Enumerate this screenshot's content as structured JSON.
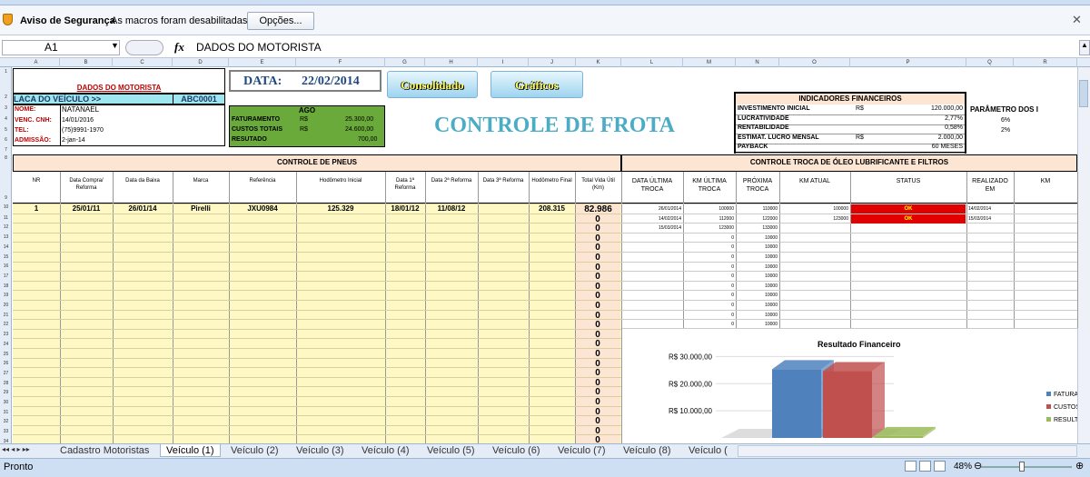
{
  "security_bar": {
    "title": "Aviso de Segurança",
    "message": "As macros foram desabilitadas.",
    "options_button": "Opções..."
  },
  "formula_bar": {
    "name_box": "A1",
    "fx": "fx",
    "value": "DADOS DO MOTORISTA"
  },
  "columns": [
    "A",
    "B",
    "C",
    "D",
    "E",
    "F",
    "G",
    "H",
    "I",
    "J",
    "K",
    "L",
    "M",
    "N",
    "O",
    "P",
    "Q",
    "R"
  ],
  "rows": [
    "1",
    "2",
    "3",
    "4",
    "5",
    "6",
    "7",
    "8",
    "9",
    "10",
    "11",
    "12",
    "13",
    "14",
    "15",
    "16",
    "17",
    "18",
    "19",
    "20",
    "21",
    "22",
    "23",
    "24",
    "25",
    "26",
    "27",
    "28",
    "29",
    "30",
    "31",
    "32",
    "33",
    "34"
  ],
  "motorista": {
    "title": "DADOS DO MOTORISTA",
    "placa_label": "LACA DO VEÍCULO >>",
    "placa_value": "ABC0001",
    "nome_label": "NOME:",
    "nome_value": "NATANAEL",
    "cnh_label": "VENC. CNH:",
    "cnh_value": "14/01/2016",
    "tel_label": "TEL:",
    "tel_value": "(75)9991-1970",
    "adm_label": "ADMISSÃO:",
    "adm_value": "2-jan-14"
  },
  "data_box": {
    "label": "DATA:",
    "value": "22/02/2014"
  },
  "buttons": {
    "consolidado": "Consolidado",
    "graficos": "Gráficos"
  },
  "mes": {
    "month": "AGO",
    "fat_label": "FATURAMENTO",
    "fat_cur": "R$",
    "fat_val": "25.300,00",
    "custo_label": "CUSTOS TOTAIS",
    "custo_cur": "R$",
    "custo_val": "24.600,00",
    "res_label": "RESUTADO",
    "res_val": "700,00"
  },
  "main_title": "CONTROLE DE FROTA",
  "indicadores": {
    "title": "INDICADORES FINANCEIROS",
    "rows": [
      {
        "label": "INVESTIMENTO INICIAL",
        "cur": "R$",
        "value": "120.000,00"
      },
      {
        "label": "LUCRATIVIDADE",
        "cur": "",
        "value": "2,77%"
      },
      {
        "label": "RENTABILIDADE",
        "cur": "",
        "value": "0,58%"
      },
      {
        "label": "ESTIMAT. LUCRO MENSAL",
        "cur": "R$",
        "value": "2.000,00"
      },
      {
        "label": "PAYBACK",
        "cur": "",
        "value": "60   MESES"
      }
    ],
    "param_title": "PARÂMETRO DOS I",
    "param_vals": [
      "6%",
      "2%"
    ]
  },
  "pneus": {
    "title": "CONTROLE DE PNEUS",
    "headers": [
      "NR",
      "Data Compra/ Reforma",
      "Data da Baixa",
      "Marca",
      "Referência",
      "Hodômetro Inicial",
      "Data 1ª Reforma",
      "Data 2ª Reforma",
      "Data 3ª Reforma",
      "Hodômetro Final",
      "Total Vida Útil (Km)"
    ],
    "row1": [
      "1",
      "25/01/11",
      "26/01/14",
      "Pirelli",
      "JXU0984",
      "125.329",
      "18/01/12",
      "11/08/12",
      "",
      "208.315",
      "82.986"
    ],
    "zero": "0"
  },
  "oleo": {
    "title": "CONTROLE TROCA DE ÓLEO LUBRIFICANTE E FILTROS",
    "headers": [
      "DATA ÚLTIMA TROCA",
      "KM ÚLTIMA TROCA",
      "PRÓXIMA TROCA",
      "KM ATUAL",
      "STATUS",
      "REALIZADO EM",
      "KM"
    ],
    "rows": [
      [
        "26/01/2014",
        "100000",
        "110000",
        "100000",
        "OK",
        "14/02/2014"
      ],
      [
        "14/02/2014",
        "112000",
        "122000",
        "123000",
        "OK",
        "15/03/2014"
      ],
      [
        "15/03/2014",
        "123000",
        "133000",
        "",
        "",
        ""
      ]
    ],
    "zero_km": "0",
    "next_default": "10000"
  },
  "chart_data": {
    "type": "bar",
    "title": "Resultado Financeiro",
    "categories": [
      "FATURAMENTO",
      "CUSTOS",
      "RESULTADO"
    ],
    "values": [
      25300,
      24600,
      700
    ],
    "ytick_labels": [
      "R$ 30.000,00",
      "R$ 20.000,00",
      "R$ 10.000,00"
    ],
    "legend": [
      "FATURAN",
      "CUSTOS",
      "RESULTAD"
    ],
    "colors": [
      "#4f81bd",
      "#c0504d",
      "#9bbb59"
    ],
    "ylim": [
      0,
      30000
    ]
  },
  "tabs": [
    "Cadastro Motoristas",
    "Veículo (1)",
    "Veículo (2)",
    "Veículo (3)",
    "Veículo (4)",
    "Veículo (5)",
    "Veículo (6)",
    "Veículo (7)",
    "Veículo (8)",
    "Veículo ("
  ],
  "status": {
    "ready": "Pronto",
    "zoom": "48%"
  }
}
